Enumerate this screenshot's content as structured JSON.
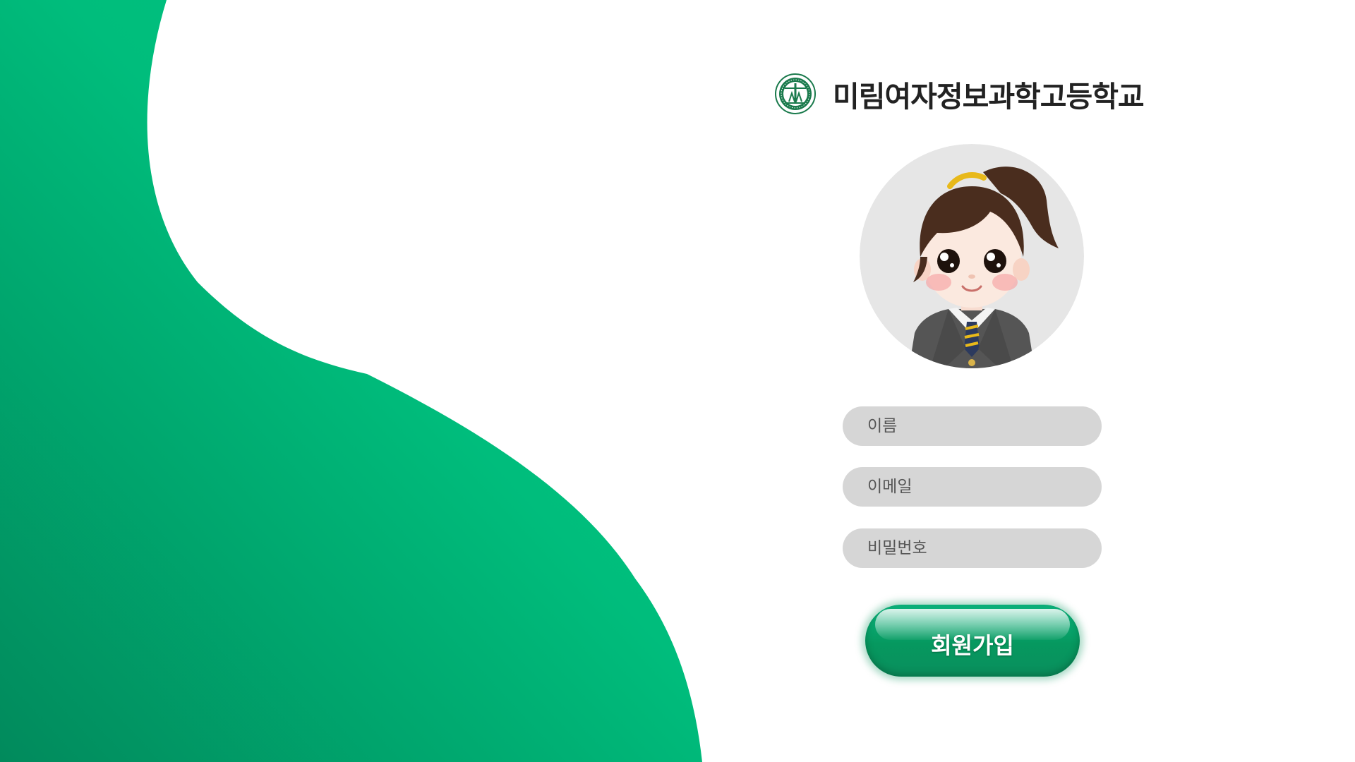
{
  "colors": {
    "brand_green": "#00bd7c",
    "brand_green_dark": "#018a5c",
    "input_background": "#d6d6d6",
    "title_text": "#222222"
  },
  "header": {
    "logo_icon": "school-emblem-icon",
    "school_name": "미림여자정보과학고등학교"
  },
  "avatar": {
    "icon": "student-character-avatar"
  },
  "form": {
    "name_placeholder": "이름",
    "email_placeholder": "이메일",
    "password_placeholder": "비밀번호",
    "submit_label": "회원가입"
  }
}
